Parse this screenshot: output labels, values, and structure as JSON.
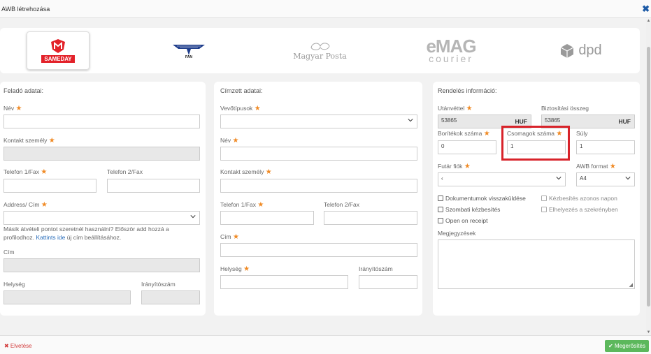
{
  "window": {
    "title": "AWB létrehozása",
    "close_symbol": "✖"
  },
  "couriers": {
    "sameday": "SAMEDAY",
    "fan": "FAN",
    "magyar_posta": "Magyar Posta",
    "emag_top": "eMAG",
    "emag_bottom": "courier",
    "dpd": "dpd"
  },
  "sender": {
    "title": "Feladó adatai:",
    "name_label": "Név",
    "contact_label": "Kontakt személy",
    "phone1_label": "Telefon 1/Fax",
    "phone2_label": "Telefon 2/Fax",
    "address_label": "Address/ Cím",
    "note_text": "Másik átvételi pontot szeretnél használni? Először add hozzá a profilodhoz. ",
    "note_link": "Kattints ide",
    "note_after": " új cím beállításához.",
    "cim_label": "Cím",
    "city_label": "Helység",
    "zip_label": "Irányítószám"
  },
  "recipient": {
    "title": "Címzett adatai:",
    "vehicle_label": "Vevőtípusok",
    "name_label": "Név",
    "contact_label": "Kontakt személy",
    "phone1_label": "Telefon 1/Fax",
    "phone2_label": "Telefon 2/Fax",
    "cim_label": "Cím",
    "city_label": "Helység",
    "zip_label": "Irányítószám"
  },
  "order": {
    "title": "Rendelés információ:",
    "cod_label": "Utánvéttel",
    "cod_value": "53865",
    "cod_currency": "HUF",
    "insurance_label": "Biztosítási összeg",
    "insurance_value": "53865",
    "insurance_currency": "HUF",
    "envelopes_label": "Borítékok száma",
    "envelopes_value": "0",
    "packages_label": "Csomagok száma",
    "packages_value": "1",
    "weight_label": "Súly",
    "weight_value": "1",
    "courier_account_label": "Futár fiók",
    "courier_account_value": "‹",
    "awb_format_label": "AWB format",
    "awb_format_value": "A4",
    "check_return_docs": "Dokumentumok visszaküldése",
    "check_same_day": "Kézbesítés azonos napon",
    "check_saturday": "Szombati kézbesítés",
    "check_locker": "Elhelyezés a szekrényben",
    "check_open": "Open on receipt",
    "notes_label": "Megjegyzések"
  },
  "footer": {
    "discard_label": "✖ Elvetése",
    "confirm_label": "✔ Megerősítés"
  },
  "colors": {
    "required_star": "#f08a24",
    "highlight": "#d8232a",
    "confirm": "#5cb85c",
    "link": "#2a6ebb"
  }
}
